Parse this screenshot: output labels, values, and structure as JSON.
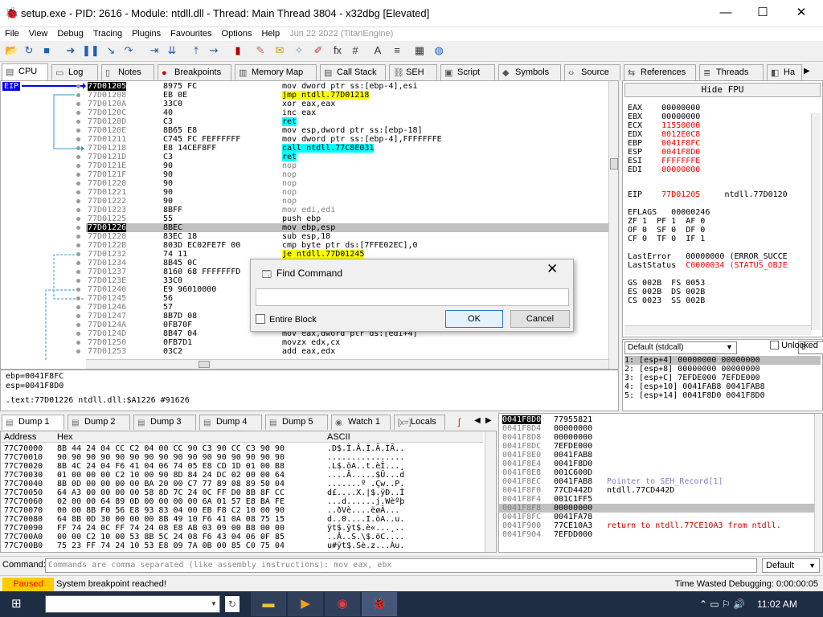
{
  "window": {
    "title": "setup.exe - PID: 2616 - Module: ntdll.dll - Thread: Main Thread 3804 - x32dbg [Elevated]"
  },
  "menu": {
    "items": [
      "File",
      "View",
      "Debug",
      "Tracing",
      "Plugins",
      "Favourites",
      "Options",
      "Help"
    ],
    "date": "Jun 22 2022 (TitanEngine)"
  },
  "tabs": [
    "CPU",
    "Log",
    "Notes",
    "Breakpoints",
    "Memory Map",
    "Call Stack",
    "SEH",
    "Script",
    "Symbols",
    "Source",
    "References",
    "Threads",
    "Ha"
  ],
  "eip_label": "EIP",
  "disasm": [
    {
      "addr": "77D01205",
      "bytes": "8975 FC",
      "asm": "mov dword ptr ss:[ebp-4],esi"
    },
    {
      "addr": "77D01208",
      "bytes": "EB 0E",
      "asm": "jmp ntdll.77D01218"
    },
    {
      "addr": "77D0120A",
      "bytes": "33C0",
      "asm": "xor eax,eax"
    },
    {
      "addr": "77D0120C",
      "bytes": "40",
      "asm": "inc eax"
    },
    {
      "addr": "77D0120D",
      "bytes": "C3",
      "asm": "ret"
    },
    {
      "addr": "77D0120E",
      "bytes": "8B65 E8",
      "asm": "mov esp,dword ptr ss:[ebp-18]"
    },
    {
      "addr": "77D01211",
      "bytes": "C745 FC FEFFFFFF",
      "asm": "mov dword ptr ss:[ebp-4],FFFFFFFE"
    },
    {
      "addr": "77D01218",
      "bytes": "E8 14CEF8FF",
      "asm": "call ntdll.77C8E031"
    },
    {
      "addr": "77D0121D",
      "bytes": "C3",
      "asm": "ret"
    },
    {
      "addr": "77D0121E",
      "bytes": "90",
      "asm": "nop"
    },
    {
      "addr": "77D0121F",
      "bytes": "90",
      "asm": "nop"
    },
    {
      "addr": "77D01220",
      "bytes": "90",
      "asm": "nop"
    },
    {
      "addr": "77D01221",
      "bytes": "90",
      "asm": "nop"
    },
    {
      "addr": "77D01222",
      "bytes": "90",
      "asm": "nop"
    },
    {
      "addr": "77D01223",
      "bytes": "8BFF",
      "asm": "mov edi,edi"
    },
    {
      "addr": "77D01225",
      "bytes": "55",
      "asm": "push ebp"
    },
    {
      "addr": "77D01226",
      "bytes": "8BEC",
      "asm": "mov ebp,esp"
    },
    {
      "addr": "77D01228",
      "bytes": "83EC 18",
      "asm": "sub esp,18"
    },
    {
      "addr": "77D0122B",
      "bytes": "803D EC02FE7F 00",
      "asm": "cmp byte ptr ds:[7FFE02EC],0"
    },
    {
      "addr": "77D01232",
      "bytes": "74 11",
      "asm": "je ntdll.77D01245"
    },
    {
      "addr": "77D01234",
      "bytes": "8B45 0C",
      "asm": "mov esp,dword ptr ss:[ebp-C]"
    },
    {
      "addr": "77D01237",
      "bytes": "8160 68 FFFFFFFD",
      "asm": "and dword ptr ds:[eax+68],FFFFFFFD"
    },
    {
      "addr": "77D0123E",
      "bytes": "33C0",
      "asm": ""
    },
    {
      "addr": "77D01240",
      "bytes": "E9 96010000",
      "asm": ""
    },
    {
      "addr": "77D01245",
      "bytes": "56",
      "asm": ""
    },
    {
      "addr": "77D01246",
      "bytes": "57",
      "asm": ""
    },
    {
      "addr": "77D01247",
      "bytes": "8B7D 08",
      "asm": ""
    },
    {
      "addr": "77D0124A",
      "bytes": "0FB70F",
      "asm": ""
    },
    {
      "addr": "77D0124D",
      "bytes": "8B47 04",
      "asm": "mov eax,dword ptr ds:[edi+4]"
    },
    {
      "addr": "77D01250",
      "bytes": "0FB7D1",
      "asm": "movzx edx,cx"
    },
    {
      "addr": "77D01253",
      "bytes": "03C2",
      "asm": "add eax,edx"
    }
  ],
  "info_lines": [
    "ebp=0041F8FC",
    "esp=0041F8D0",
    "",
    ".text:77D01226 ntdll.dll:$A1226 #91626"
  ],
  "hide_fpu": "Hide FPU",
  "registers": [
    {
      "name": "EAX",
      "val": "00000000",
      "red": false
    },
    {
      "name": "EBX",
      "val": "00000000",
      "red": false
    },
    {
      "name": "ECX",
      "val": "11550000",
      "red": true
    },
    {
      "name": "EDX",
      "val": "0012E0C8",
      "red": true
    },
    {
      "name": "EBP",
      "val": "0041F8FC",
      "red": true
    },
    {
      "name": "ESP",
      "val": "0041F8D0",
      "red": true
    },
    {
      "name": "ESI",
      "val": "FFFFFFFE",
      "red": true
    },
    {
      "name": "EDI",
      "val": "00000000",
      "red": true
    }
  ],
  "eip_line": {
    "name": "EIP",
    "val": "77D01205",
    "sym": "ntdll.77D0120"
  },
  "eflags": "EFLAGS   00000246",
  "flags": [
    "ZF 1  PF 1  AF 0",
    "OF 0  SF 0  DF 0",
    "CF 0  TF 0  IF 1"
  ],
  "lasterror": {
    "label": "LastError",
    "val": "00000000",
    "desc": "(ERROR_SUCCE"
  },
  "laststatus": {
    "label": "LastStatus",
    "val": "C0000034",
    "desc": "(STATUS_OBJE"
  },
  "segs": [
    "GS 002B  FS 0053",
    "ES 002B  DS 002B",
    "CS 0023  SS 002B"
  ],
  "callconv": {
    "value": "Default (stdcall)",
    "n": "5",
    "unlocked": "Unlocked"
  },
  "args": [
    "1: [esp+4] 00000000 00000000",
    "2: [esp+8] 00000000 00000000",
    "3: [esp+C] 7EFDE000 7EFDE000",
    "4: [esp+10] 0041FAB8 0041FAB8",
    "5: [esp+14] 0041F8D0 0041F8D0"
  ],
  "btabs": [
    "Dump 1",
    "Dump 2",
    "Dump 3",
    "Dump 4",
    "Dump 5",
    "Watch 1",
    "Locals"
  ],
  "dump_hdr": {
    "addr": "Address",
    "hex": "Hex",
    "ascii": "ASCII"
  },
  "dump": [
    {
      "a": "77C70000",
      "h": "8B 44 24 04 CC C2 04 00 CC 90 C3 90 CC C3 90 90",
      "c": ".D$.Ì.Â.Ì.Ã.ÌÃ.."
    },
    {
      "a": "77C70010",
      "h": "90 90 90 90 90 90 90 90 90 90 90 90 90 90 90 90",
      "c": "................"
    },
    {
      "a": "77C70020",
      "h": "8B 4C 24 04 F6 41 04 06 74 05 E8 CD 1D 01 00 B8",
      "c": ".L$.öA..t.èÍ...¸"
    },
    {
      "a": "77C70030",
      "h": "01 00 00 00 C2 10 00 90 8D 84 24 DC 02 00 00 64",
      "c": "....Â.....$Ü...d"
    },
    {
      "a": "77C70040",
      "h": "8B 0D 00 00 00 00 BA 20 00 C7 77 89 08 89 50 04",
      "c": ".......º .Çw..P."
    },
    {
      "a": "77C70050",
      "h": "64 A3 00 00 00 00 58 8D 7C 24 0C FF D0 8B 8F CC",
      "c": "d£....X.|$.ÿÐ..Ì"
    },
    {
      "a": "77C70060",
      "h": "02 00 00 64 89 0D 00 00 00 00 6A 01 57 E8 BA FE",
      "c": "...d......j.Wèºþ"
    },
    {
      "a": "77C70070",
      "h": "00 00 8B F0 56 E8 93 83 04 00 EB F8 C2 10 00 90",
      "c": "..ðVè....ëøÂ..."
    },
    {
      "a": "77C70080",
      "h": "64 8B 0D 30 00 00 00 8B 49 10 F6 41 0A 08 75 15",
      "c": "d..0....I.öA..u."
    },
    {
      "a": "77C70090",
      "h": "FF 74 24 0C FF 74 24 08 E8 AB 03 09 00 B8 00 00",
      "c": "ÿt$.ÿt$.è«...¸.."
    },
    {
      "a": "77C700A0",
      "h": "00 00 C2 10 00 53 8B 5C 24 08 F6 43 04 06 0F 85",
      "c": "..Â..S.\\$.öC...."
    },
    {
      "a": "77C700B0",
      "h": "75 23 FF 74 24 10 53 E8 09 7A 0B 00 85 C0 75 04",
      "c": "u#ÿt$.Sè.z...Àu."
    }
  ],
  "stack": [
    {
      "a": "0041F8D0",
      "v": "77955821",
      "c": ""
    },
    {
      "a": "0041F8D4",
      "v": "00000000",
      "c": ""
    },
    {
      "a": "0041F8D8",
      "v": "00000000",
      "c": ""
    },
    {
      "a": "0041F8DC",
      "v": "7EFDE000",
      "c": ""
    },
    {
      "a": "0041F8E0",
      "v": "0041FAB8",
      "c": ""
    },
    {
      "a": "0041F8E4",
      "v": "0041F8D0",
      "c": ""
    },
    {
      "a": "0041F8E8",
      "v": "001C600D",
      "c": ""
    },
    {
      "a": "0041F8EC",
      "v": "0041FAB8",
      "c": "Pointer to SEH_Record[1]"
    },
    {
      "a": "0041F8F0",
      "v": "77CD442D",
      "c": "ntdll.77CD442D"
    },
    {
      "a": "0041F8F4",
      "v": "001C1FF5",
      "c": ""
    },
    {
      "a": "0041F8F8",
      "v": "00000000",
      "c": ""
    },
    {
      "a": "0041F8FC",
      "v": "0041FA78",
      "c": ""
    },
    {
      "a": "0041F900",
      "v": "77CE10A3",
      "c": "return to ntdll.77CE10A3 from ntdll."
    },
    {
      "a": "0041F904",
      "v": "7EFDD000",
      "c": ""
    }
  ],
  "cmd": {
    "label": "Command:",
    "placeholder": "Commands are comma separated (like assembly instructions): mov eax, ebx",
    "default": "Default"
  },
  "status": {
    "state": "Paused",
    "msg": "System breakpoint reached!",
    "wasted": "Time Wasted Debugging: 0:00:00:05"
  },
  "find": {
    "title": "Find Command",
    "chk": "Entire Block",
    "ok": "OK",
    "cancel": "Cancel"
  },
  "clock": "11:02 AM"
}
